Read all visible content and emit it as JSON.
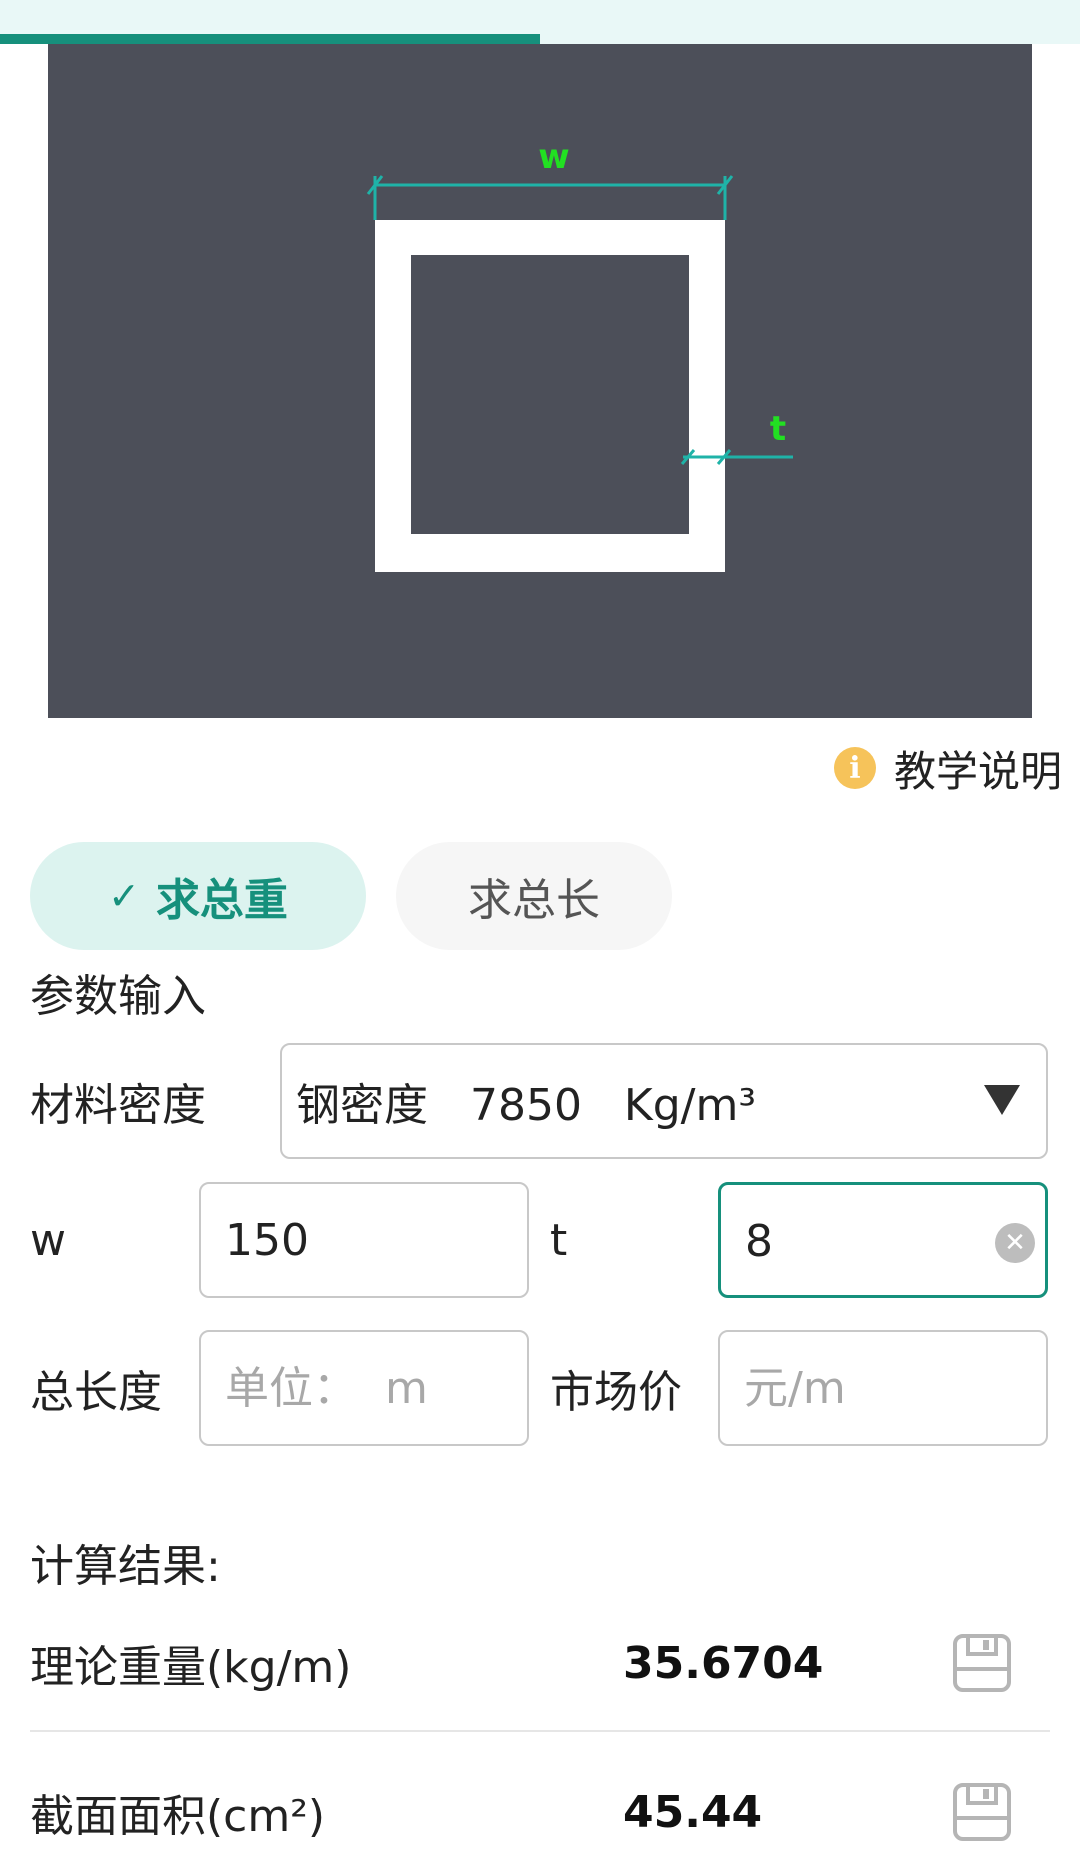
{
  "progress": {
    "percent": 50
  },
  "diagram": {
    "label_w": "w",
    "label_t": "t",
    "accent_line_color": "#1fb3a8",
    "label_color": "#22e022"
  },
  "help": {
    "icon": "info-icon",
    "label": "教学说明"
  },
  "tabs": [
    {
      "label": "求总重",
      "active": true
    },
    {
      "label": "求总长",
      "active": false
    }
  ],
  "inputs_section": {
    "title": "参数输入",
    "density": {
      "label": "材料密度",
      "value": "钢密度   7850   Kg/m³"
    },
    "w": {
      "label": "w",
      "value": "150"
    },
    "t": {
      "label": "t",
      "value": "8"
    },
    "total_length": {
      "label": "总长度",
      "placeholder": "单位：  m",
      "value": ""
    },
    "market_price": {
      "label": "市场价",
      "placeholder": "元/m",
      "value": ""
    }
  },
  "results": {
    "title": "计算结果:",
    "rows": [
      {
        "label": "理论重量(kg/m)",
        "value": "35.6704"
      },
      {
        "label": "截面面积(cm²)",
        "value": "45.44"
      }
    ]
  },
  "colors": {
    "accent": "#16907c",
    "tab_active_bg": "#dcf3ef",
    "diagram_bg": "#4c4f59",
    "info_icon": "#f6c35a"
  }
}
